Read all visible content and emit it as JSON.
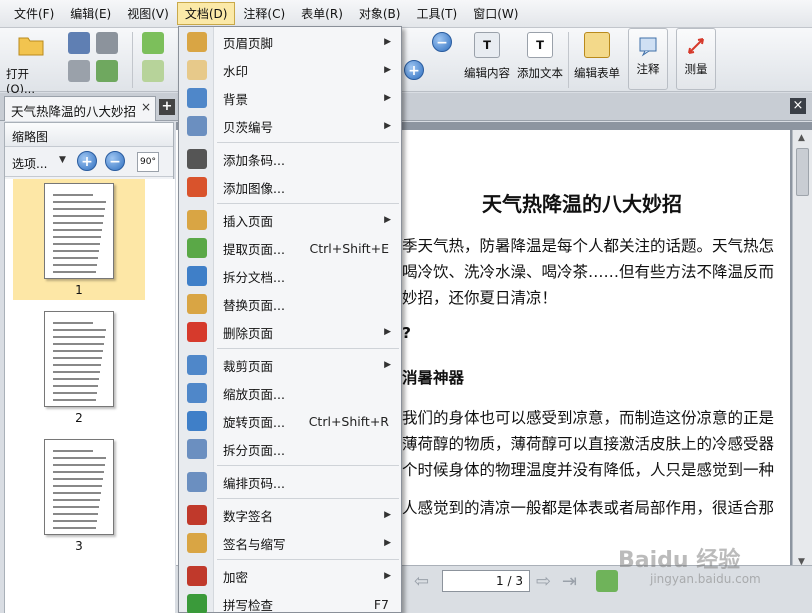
{
  "menubar": {
    "items": [
      "文件(F)",
      "编辑(E)",
      "视图(V)",
      "文档(D)",
      "注释(C)",
      "表单(R)",
      "对象(B)",
      "工具(T)",
      "窗口(W)"
    ],
    "active_index": 3
  },
  "toolbar": {
    "open_label": "打开(O)...",
    "edit_content_label": "编辑内容",
    "add_text_label": "添加文本",
    "edit_form_label": "编辑表单",
    "comment_label": "注释",
    "measure_label": "测量"
  },
  "tabs": {
    "doc_tab_label": "天气热降温的八大妙招",
    "add_icon": "+",
    "close_icon": "×"
  },
  "thumbnails": {
    "title": "缩略图",
    "options_label": "选项...",
    "rotate_label": "90°",
    "pages": [
      "1",
      "2",
      "3"
    ],
    "selected_index": 0
  },
  "document": {
    "heading": "天气热降温的八大妙招",
    "lines": [
      {
        "text": "季天气热，防暑降温是每个人都关注的话题。天气热怎",
        "bold": false
      },
      {
        "text": "喝冷饮、洗冷水澡、喝冷茶……但有些方法不降温反而",
        "bold": false
      },
      {
        "text": "妙招，还你夏日清凉！",
        "bold": false
      },
      {
        "text": "?",
        "bold": true
      },
      {
        "text": "消暑神器",
        "bold": true
      },
      {
        "text": "我们的身体也可以感受到凉意，而制造这份凉意的正是",
        "bold": false
      },
      {
        "text": "薄荷醇的物质，薄荷醇可以直接激活皮肤上的冷感受器",
        "bold": false
      },
      {
        "text": "个时候身体的物理温度并没有降低，人只是感觉到一种",
        "bold": false
      },
      {
        "text": "人感觉到的清凉一般都是体表或者局部作用，很适合那",
        "bold": false
      }
    ]
  },
  "navigation": {
    "page_display": "1 / 3"
  },
  "dropdown": {
    "items": [
      {
        "label": "页眉页脚",
        "shortcut": "",
        "submenu": true,
        "icon": "header-footer-icon",
        "color": "#d9a544"
      },
      {
        "label": "水印",
        "shortcut": "",
        "submenu": true,
        "icon": "watermark-icon",
        "color": "#e7c98a"
      },
      {
        "label": "背景",
        "shortcut": "",
        "submenu": true,
        "icon": "background-icon",
        "color": "#4f87c9"
      },
      {
        "label": "贝茨编号",
        "shortcut": "",
        "submenu": true,
        "icon": "bates-number-icon",
        "color": "#6b8fc0"
      },
      {
        "label": "添加条码...",
        "shortcut": "",
        "submenu": false,
        "icon": "barcode-icon",
        "color": "#555555"
      },
      {
        "label": "添加图像...",
        "shortcut": "",
        "submenu": false,
        "icon": "image-add-icon",
        "color": "#d9532c"
      },
      {
        "label": "插入页面",
        "shortcut": "",
        "submenu": true,
        "icon": "insert-page-icon",
        "color": "#d9a544"
      },
      {
        "label": "提取页面...",
        "shortcut": "Ctrl+Shift+E",
        "submenu": false,
        "icon": "extract-page-icon",
        "color": "#5aa847"
      },
      {
        "label": "拆分文档...",
        "shortcut": "",
        "submenu": false,
        "icon": "split-document-icon",
        "color": "#3f7fc8"
      },
      {
        "label": "替换页面...",
        "shortcut": "",
        "submenu": false,
        "icon": "replace-page-icon",
        "color": "#d9a544"
      },
      {
        "label": "删除页面",
        "shortcut": "",
        "submenu": true,
        "icon": "delete-page-icon",
        "color": "#d63a2c"
      },
      {
        "label": "裁剪页面",
        "shortcut": "",
        "submenu": true,
        "icon": "crop-page-icon",
        "color": "#4f87c9"
      },
      {
        "label": "缩放页面...",
        "shortcut": "",
        "submenu": false,
        "icon": "scale-page-icon",
        "color": "#4f87c9"
      },
      {
        "label": "旋转页面...",
        "shortcut": "Ctrl+Shift+R",
        "submenu": false,
        "icon": "rotate-page-icon",
        "color": "#3f7fc8"
      },
      {
        "label": "拆分页面...",
        "shortcut": "",
        "submenu": false,
        "icon": "split-page-icon",
        "color": "#6b8fc0"
      },
      {
        "label": "编排页码...",
        "shortcut": "",
        "submenu": false,
        "icon": "page-numbering-icon",
        "color": "#6b8fc0"
      },
      {
        "label": "数字签名",
        "shortcut": "",
        "submenu": true,
        "icon": "digital-signature-icon",
        "color": "#c0392b"
      },
      {
        "label": "签名与缩写",
        "shortcut": "",
        "submenu": true,
        "icon": "sign-initial-icon",
        "color": "#d9a544"
      },
      {
        "label": "加密",
        "shortcut": "",
        "submenu": true,
        "icon": "encrypt-icon",
        "color": "#c0392b"
      },
      {
        "label": "拼写检查",
        "shortcut": "F7",
        "submenu": false,
        "icon": "spell-check-icon",
        "color": "#3a9a3a"
      }
    ]
  },
  "watermark": {
    "logo": "Baidu 经验",
    "sub": "jingyan.baidu.com"
  },
  "colors": {
    "menu_active": "#fbe9a8",
    "thumb_selected": "#fde7a6",
    "accent_blue": "#2f6fc0"
  }
}
